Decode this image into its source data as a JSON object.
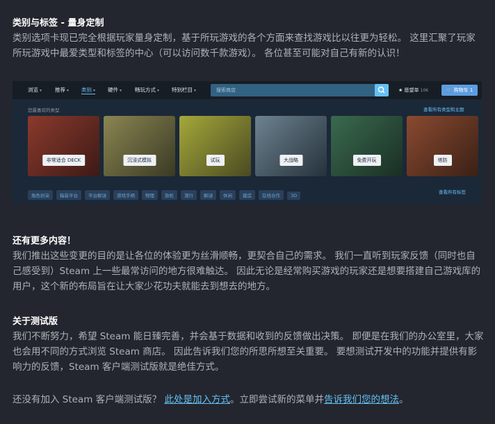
{
  "section1": {
    "heading": "类别与标签 - 量身定制",
    "body": "类别选项卡现已完全根据玩家量身定制，基于所玩游戏的各个方面来查找游戏比以往更为轻松。 这里汇聚了玩家所玩游戏中最爱类型和标签的中心（可以访问数千款游戏）。 各位甚至可能对自己有新的认识！"
  },
  "screenshot": {
    "nav": [
      "浏览",
      "推荐",
      "类别",
      "硬件",
      "畅玩方式",
      "特别栏目"
    ],
    "nav_active": "类别",
    "search_placeholder": "搜索商店",
    "wishlist_label": "愿望单",
    "wishlist_count": "106",
    "cart_label": "购物车 1",
    "subheader_left": "您最喜欢的类型",
    "subheader_right": "查看所有类型和主题",
    "cards": [
      {
        "label": "非常适合 DECK",
        "color": "#7a2d24"
      },
      {
        "label": "沉浸式模拟",
        "color": "#6b6a3a"
      },
      {
        "label": "试玩",
        "color": "#7d8a2a"
      },
      {
        "label": "大战略",
        "color": "#3a5a6e"
      },
      {
        "label": "免费开玩",
        "color": "#274a3a"
      },
      {
        "label": "塔防",
        "color": "#6a3a28"
      }
    ],
    "tags": [
      "角色扮演",
      "箱装平台",
      "平台解谜",
      "游戏手柄",
      "物理",
      "放松",
      "潜行",
      "解谜",
      "休闲",
      "建造",
      "在线合作",
      "3D"
    ],
    "tags_right": "查看所有标签"
  },
  "section2": {
    "heading": "还有更多内容！",
    "body": "我们推出这些变更的目的是让各位的体验更为丝滑顺畅，更契合自己的需求。 我们一直听到玩家反馈（同时也自己感受到）Steam 上一些最常访问的地方很难触达。 因此无论是经常购买游戏的玩家还是想要搭建自己游戏库的用户，这个新的布局旨在让大家少花功夫就能去到想去的地方。"
  },
  "section3": {
    "heading": "关于测试版",
    "body": "我们不断努力，希望 Steam 能日臻完善，并会基于数据和收到的反馈做出决策。 即便是在我们的办公室里，大家也会用不同的方式浏览 Steam 商店。 因此告诉我们您的所思所想至关重要。 要想测试开发中的功能并提供有影响力的反馈，Steam 客户端测试版就是绝佳方式。"
  },
  "footer": {
    "text_before": "还没有加入 Steam 客户端测试版？ ",
    "link1": "此处是加入方式",
    "text_middle": "。立即尝试新的菜单并",
    "link2": "告诉我们您的想法",
    "text_after": "。"
  }
}
